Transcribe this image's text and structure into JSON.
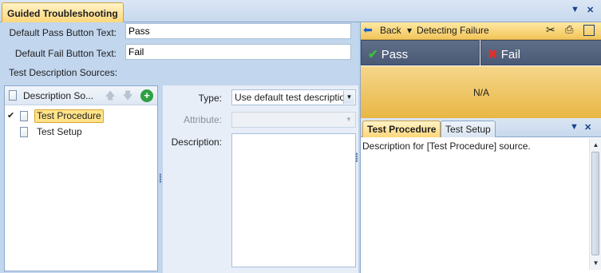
{
  "window": {
    "tab_title": "Guided Troubleshooting",
    "menu_glyph": "▼",
    "close_glyph": "✕"
  },
  "form": {
    "pass_label": "Default Pass Button Text:",
    "pass_value": "Pass",
    "fail_label": "Default Fail Button Text:",
    "fail_value": "Fail",
    "sources_label": "Test Description Sources:"
  },
  "tree": {
    "header": "Description So...",
    "up_glyph": "🡅",
    "down_glyph": "🡇",
    "add_glyph": "+",
    "items": [
      {
        "label": "Test Procedure",
        "checked": "✔",
        "selected": true
      },
      {
        "label": "Test Setup",
        "checked": "",
        "selected": false
      }
    ]
  },
  "properties": {
    "type_label": "Type:",
    "type_value": "Use default test descriptio",
    "attribute_label": "Attribute:",
    "attribute_value": "",
    "description_label": "Description:",
    "description_value": ""
  },
  "preview": {
    "back_label": "Back",
    "back_arrow": "⬅",
    "dropdown_arrow": "▾",
    "step_title": "Detecting Failure",
    "pass_label": "Pass",
    "pass_glyph": "✔",
    "fail_label": "Fail",
    "fail_glyph": "✖",
    "na_label": "N/A",
    "tabs": [
      "Test Procedure",
      "Test Setup"
    ],
    "description_text": "Description for [Test Procedure] source."
  },
  "colors": {
    "accent_gold": "#f2c45a",
    "pass_green": "#3fbf3f",
    "fail_red": "#e0302a",
    "add_green": "#2ea043"
  }
}
